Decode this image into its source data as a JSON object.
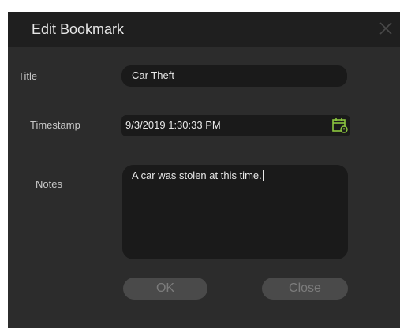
{
  "dialog": {
    "title": "Edit Bookmark",
    "close_icon": "close-icon"
  },
  "form": {
    "title_label": "Title",
    "title_value": "Car Theft",
    "timestamp_label": "Timestamp",
    "timestamp_value": "9/3/2019 1:30:33 PM",
    "calendar_icon": "calendar-icon",
    "notes_label": "Notes",
    "notes_value": "A car was stolen at this time."
  },
  "buttons": {
    "ok_label": "OK",
    "close_label": "Close"
  },
  "colors": {
    "dialog_bg": "#2c2c2c",
    "titlebar_bg": "#1f1f1f",
    "field_bg": "#1a1a1a",
    "button_bg": "#4a4a4a",
    "accent_calendar": "#8cc63f"
  }
}
